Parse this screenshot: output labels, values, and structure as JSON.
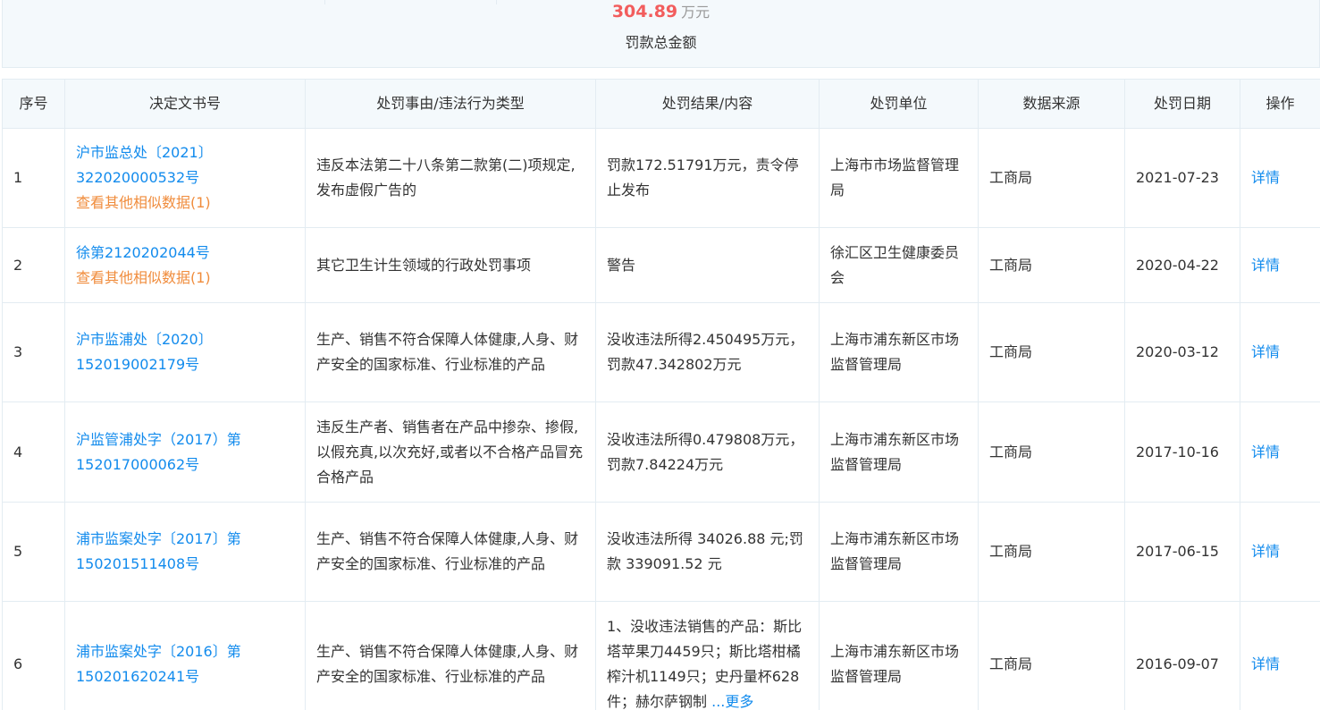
{
  "summary": {
    "amount": "304.89",
    "unit": "万元",
    "label": "罚款总金额"
  },
  "table": {
    "headers": [
      "序号",
      "决定文书号",
      "处罚事由/违法行为类型",
      "处罚结果/内容",
      "处罚单位",
      "数据来源",
      "处罚日期",
      "操作"
    ],
    "rows": [
      {
        "index": "1",
        "doc_no": "沪市监总处〔2021〕322020000532号",
        "similar": "查看其他相似数据(1)",
        "reason": "违反本法第二十八条第二款第(二)项规定,发布虚假广告的",
        "result": "罚款172.51791万元，责令停止发布",
        "unit": "上海市市场监督管理局",
        "source": "工商局",
        "date": "2021-07-23",
        "action": "详情"
      },
      {
        "index": "2",
        "doc_no": "徐第2120202044号",
        "similar": "查看其他相似数据(1)",
        "reason": "其它卫生计生领域的行政处罚事项",
        "result": "警告",
        "unit": "徐汇区卫生健康委员会",
        "source": "工商局",
        "date": "2020-04-22",
        "action": "详情"
      },
      {
        "index": "3",
        "doc_no": "沪市监浦处〔2020〕152019002179号",
        "similar": "",
        "reason": "生产、销售不符合保障人体健康,人身、财产安全的国家标准、行业标准的产品",
        "result": "没收违法所得2.450495万元，罚款47.342802万元",
        "unit": "上海市浦东新区市场监督管理局",
        "source": "工商局",
        "date": "2020-03-12",
        "action": "详情"
      },
      {
        "index": "4",
        "doc_no": "沪监管浦处字（2017）第152017000062号",
        "similar": "",
        "reason": "违反生产者、销售者在产品中掺杂、掺假,以假充真,以次充好,或者以不合格产品冒充合格产品",
        "result": "没收违法所得0.479808万元，罚款7.84224万元",
        "unit": "上海市浦东新区市场监督管理局",
        "source": "工商局",
        "date": "2017-10-16",
        "action": "详情"
      },
      {
        "index": "5",
        "doc_no": "浦市监案处字〔2017〕第150201511408号",
        "similar": "",
        "reason": "生产、销售不符合保障人体健康,人身、财产安全的国家标准、行业标准的产品",
        "result": "没收违法所得 34026.88 元;罚款 339091.52 元",
        "unit": "上海市浦东新区市场监督管理局",
        "source": "工商局",
        "date": "2017-06-15",
        "action": "详情"
      },
      {
        "index": "6",
        "doc_no": "浦市监案处字〔2016〕第150201620241号",
        "similar": "",
        "reason": "生产、销售不符合保障人体健康,人身、财产安全的国家标准、行业标准的产品",
        "result": "1、没收违法销售的产品：斯比塔苹果刀4459只；斯比塔柑橘榨汁机1149只；史丹量杯628件；赫尔萨钢制",
        "result_more": "...更多",
        "unit": "上海市浦东新区市场监督管理局",
        "source": "工商局",
        "date": "2016-09-07",
        "action": "详情"
      }
    ]
  }
}
